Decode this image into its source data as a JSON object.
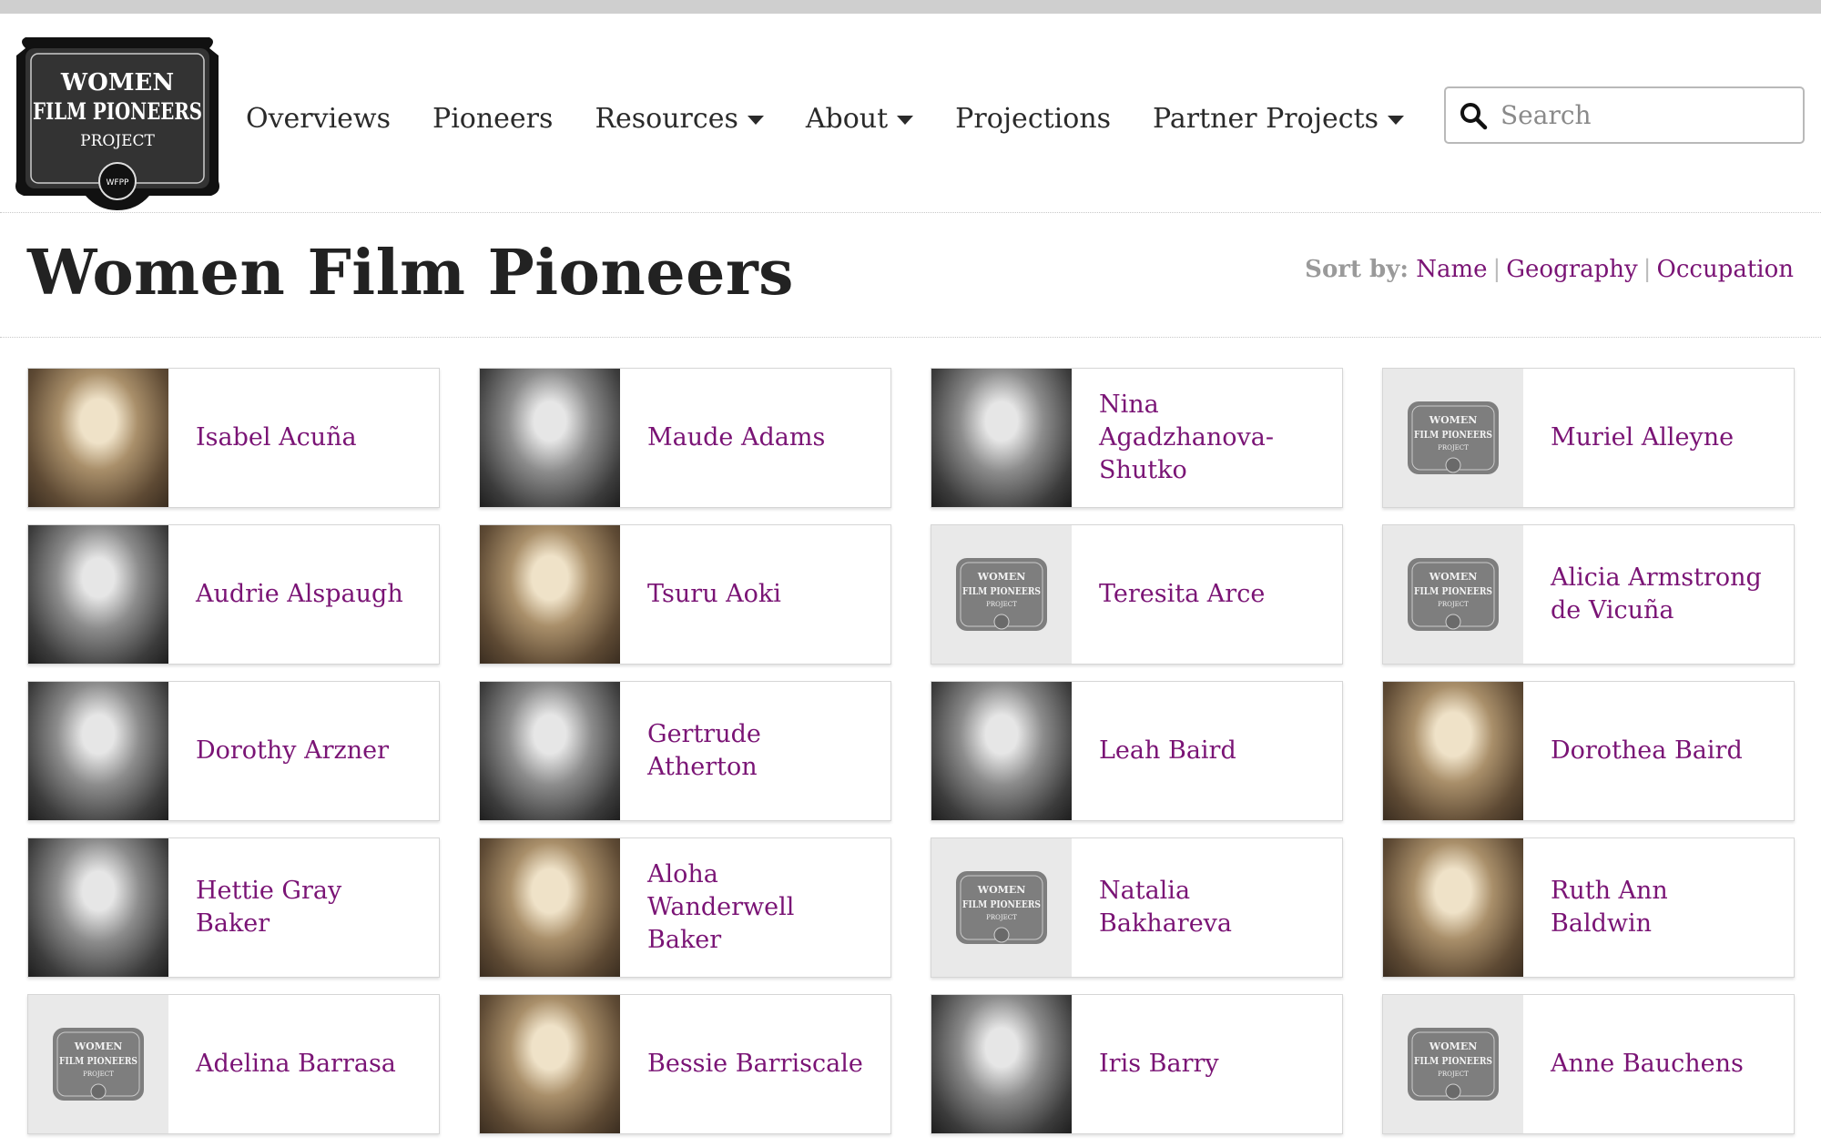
{
  "header": {
    "logo": {
      "line1": "WOMEN",
      "line2": "FILM PIONEERS",
      "line3": "PROJECT",
      "seal": "WFPP"
    },
    "nav": [
      {
        "label": "Overviews",
        "dropdown": false
      },
      {
        "label": "Pioneers",
        "dropdown": false
      },
      {
        "label": "Resources",
        "dropdown": true
      },
      {
        "label": "About",
        "dropdown": true
      },
      {
        "label": "Projections",
        "dropdown": false
      },
      {
        "label": "Partner Projects",
        "dropdown": true
      }
    ],
    "search": {
      "placeholder": "Search",
      "icon": "search-icon"
    }
  },
  "page": {
    "title": "Women Film Pioneers",
    "sort": {
      "label": "Sort by:",
      "options": [
        "Name",
        "Geography",
        "Occupation"
      ],
      "separator": "|"
    }
  },
  "colors": {
    "link": "#7a1475",
    "text": "#222222",
    "muted": "#9a9a9a"
  },
  "placeholder_logo": {
    "line1": "WOMEN",
    "line2": "FILM PIONEERS",
    "line3": "PROJECT"
  },
  "pioneers": [
    {
      "name": "Isabel Acuña",
      "photo": "sepia"
    },
    {
      "name": "Maude Adams",
      "photo": "bw"
    },
    {
      "name": "Nina Agadzhanova-Shutko",
      "photo": "bw"
    },
    {
      "name": "Muriel Alleyne",
      "photo": "placeholder"
    },
    {
      "name": "Audrie Alspaugh",
      "photo": "bw"
    },
    {
      "name": "Tsuru Aoki",
      "photo": "sepia"
    },
    {
      "name": "Teresita Arce",
      "photo": "placeholder"
    },
    {
      "name": "Alicia Armstrong de Vicuña",
      "photo": "placeholder"
    },
    {
      "name": "Dorothy Arzner",
      "photo": "bw"
    },
    {
      "name": "Gertrude Atherton",
      "photo": "bw"
    },
    {
      "name": "Leah Baird",
      "photo": "bw"
    },
    {
      "name": "Dorothea Baird",
      "photo": "sepia"
    },
    {
      "name": "Hettie Gray Baker",
      "photo": "bw"
    },
    {
      "name": "Aloha Wanderwell Baker",
      "photo": "sepia"
    },
    {
      "name": "Natalia Bakhareva",
      "photo": "placeholder"
    },
    {
      "name": "Ruth Ann Baldwin",
      "photo": "sepia"
    },
    {
      "name": "Adelina Barrasa",
      "photo": "placeholder"
    },
    {
      "name": "Bessie Barriscale",
      "photo": "sepia"
    },
    {
      "name": "Iris Barry",
      "photo": "bw"
    },
    {
      "name": "Anne Bauchens",
      "photo": "placeholder"
    }
  ]
}
